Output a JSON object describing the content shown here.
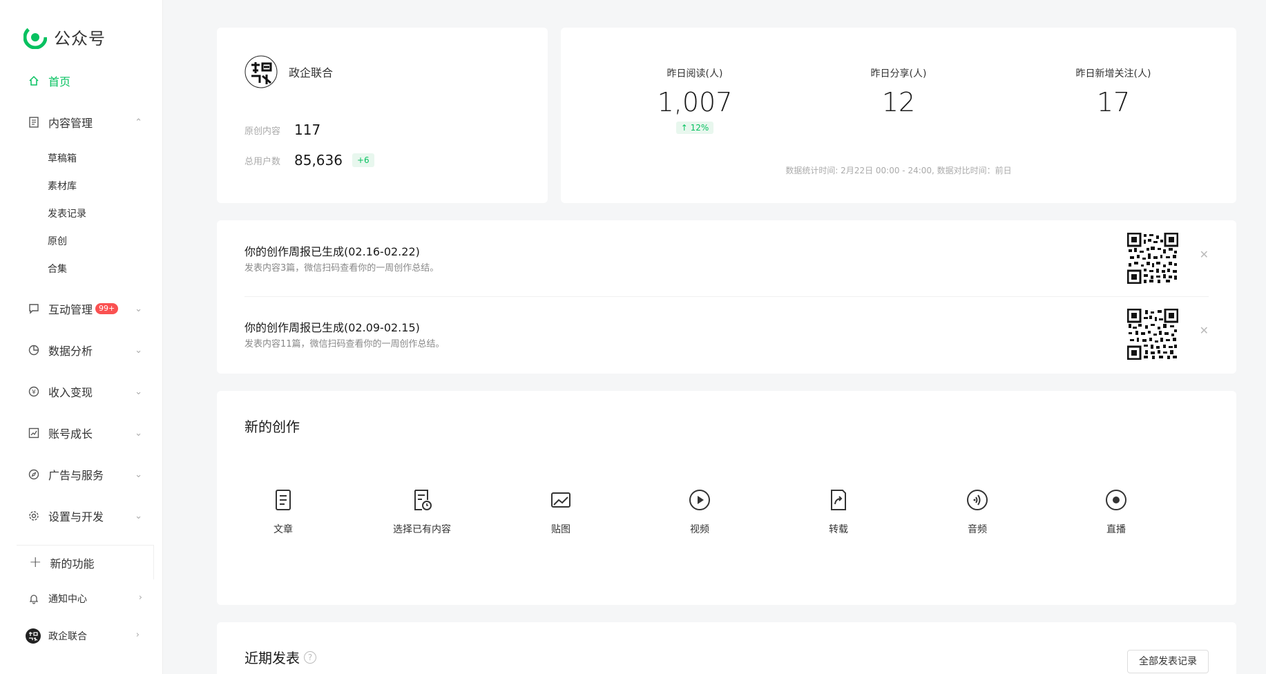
{
  "sidebar": {
    "logo_text": "公众号",
    "home": "首页",
    "content_mgmt": "内容管理",
    "sub_items": [
      "草稿箱",
      "素材库",
      "发表记录",
      "原创",
      "合集"
    ],
    "interaction": "互动管理",
    "interaction_badge": "99+",
    "data_analysis": "数据分析",
    "income": "收入变现",
    "growth": "账号成长",
    "ads": "广告与服务",
    "settings": "设置与开发",
    "new_feature": "新的功能",
    "notification": "通知中心",
    "account": "政企联合"
  },
  "account": {
    "name": "政企联合",
    "original_label": "原创内容",
    "original_value": "117",
    "users_label": "总用户数",
    "users_value": "85,636",
    "users_delta": "+6"
  },
  "stats": {
    "reads_label": "昨日阅读(人)",
    "reads_value": "1,007",
    "reads_change": "12%",
    "shares_label": "昨日分享(人)",
    "shares_value": "12",
    "follows_label": "昨日新增关注(人)",
    "follows_value": "17",
    "note": "数据统计时间: 2月22日 00:00 - 24:00, 数据对比时间：前日"
  },
  "reports": [
    {
      "title": "你的创作周报已生成(02.16-02.22)",
      "desc": "发表内容3篇，微信扫码查看你的一周创作总结。"
    },
    {
      "title": "你的创作周报已生成(02.09-02.15)",
      "desc": "发表内容11篇，微信扫码查看你的一周创作总结。"
    }
  ],
  "create": {
    "title": "新的创作",
    "items": [
      "文章",
      "选择已有内容",
      "贴图",
      "视频",
      "转载",
      "音频",
      "直播"
    ]
  },
  "recent": {
    "title": "近期发表",
    "help": "?",
    "all_button": "全部发表记录"
  },
  "colors": {
    "accent": "#07c160",
    "badge": "#fa5151"
  }
}
